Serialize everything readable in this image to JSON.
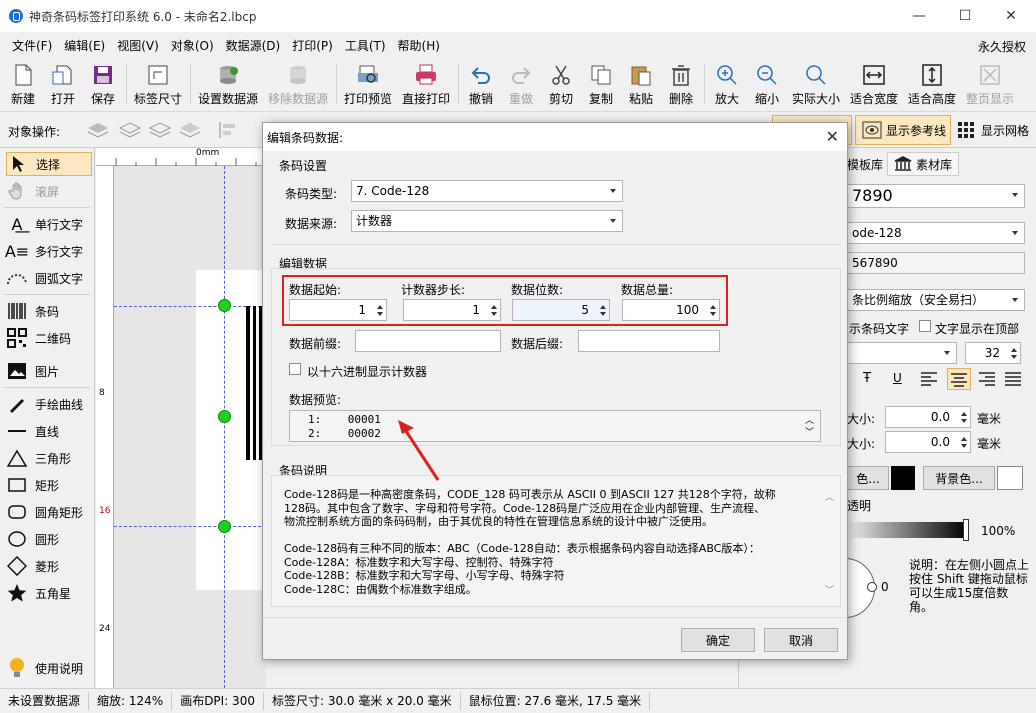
{
  "window": {
    "title": "神奇条码标签打印系统 6.0 - 未命名2.lbcp",
    "minimize": "—",
    "maximize": "☐",
    "close": "✕"
  },
  "menu": [
    "文件(F)",
    "编辑(E)",
    "视图(V)",
    "对象(O)",
    "数据源(D)",
    "打印(P)",
    "工具(T)",
    "帮助(H)"
  ],
  "license": "永久授权",
  "toolbar": {
    "new": "新建",
    "open": "打开",
    "save": "保存",
    "label_size": "标签尺寸",
    "set_datasource": "设置数据源",
    "remove_datasource": "移除数据源",
    "print_preview": "打印预览",
    "direct_print": "直接打印",
    "undo": "撤销",
    "redo": "重做",
    "cut": "剪切",
    "copy": "复制",
    "paste": "粘贴",
    "delete": "删除",
    "zoom_in": "放大",
    "zoom_out": "缩小",
    "actual_size": "实际大小",
    "fit_width": "适合宽度",
    "fit_height": "适合高度",
    "full_page": "整页显示"
  },
  "oprow": {
    "label": "对象操作:",
    "show_guides": "显示参考线",
    "show_grid": "显示网格"
  },
  "leftpanel": {
    "select": "选择",
    "scroll": "滚屏",
    "single_text": "单行文字",
    "multi_text": "多行文字",
    "arc_text": "圆弧文字",
    "barcode": "条码",
    "qrcode": "二维码",
    "image": "图片",
    "freehand": "手绘曲线",
    "line": "直线",
    "triangle": "三角形",
    "rectangle": "矩形",
    "rounded_rect": "圆角矩形",
    "circle": "圆形",
    "diamond": "菱形",
    "star": "五角星",
    "help": "使用说明"
  },
  "ruler": {
    "top_zero": "0mm",
    "marks": [
      "8",
      "16",
      "24"
    ]
  },
  "rightpanel": {
    "tab_templates": "模板库",
    "tab_materials": "素材库",
    "value": "7890",
    "type": "ode-128",
    "data": "567890",
    "scale_mode": "条比例缩放（安全易扫）",
    "show_text": "示条码文字",
    "text_top": "文字显示在顶部",
    "font_size": "32",
    "size_label1": "大小:",
    "size_val1": "0.0",
    "unit1": "毫米",
    "size_label2": "大小:",
    "size_val2": "0.0",
    "unit2": "毫米",
    "fg_color": "色...",
    "bg_color": "背景色...",
    "transparency": "透明",
    "percent": "100%",
    "angle": "0",
    "note": "说明：在左侧小圆点上按住 Shift 键拖动鼠标可以生成15度倍数角。"
  },
  "status": [
    "未设置数据源",
    "缩放: 124%",
    "画布DPI: 300",
    "标签尺寸: 30.0 毫米 x 20.0 毫米",
    "鼠标位置: 27.6 毫米, 17.5 毫米"
  ],
  "dialog": {
    "title": "编辑条码数据:",
    "barcode_settings": "条码设置",
    "type_label": "条码类型:",
    "type_value": "7. Code-128",
    "source_label": "数据来源:",
    "source_value": "计数器",
    "edit_data": "编辑数据",
    "start_label": "数据起始:",
    "start_value": "1",
    "step_label": "计数器步长:",
    "step_value": "1",
    "digits_label": "数据位数:",
    "digits_value": "5",
    "total_label": "数据总量:",
    "total_value": "100",
    "prefix_label": "数据前缀:",
    "suffix_label": "数据后缀:",
    "hex_label": "以十六进制显示计数器",
    "preview_label": "数据预览:",
    "preview_rows": [
      {
        "idx": "1:",
        "val": "00001"
      },
      {
        "idx": "2:",
        "val": "00002"
      }
    ],
    "desc_title": "条码说明",
    "desc_lines": [
      "Code-128码是一种高密度条码，CODE_128 码可表示从 ASCII 0 到ASCII 127 共128个字符，故称",
      "128码。其中包含了数字、字母和符号字符。Code-128码是广泛应用在企业内部管理、生产流程、",
      "物流控制系统方面的条码码制，由于其优良的特性在管理信息系统的设计中被广泛使用。",
      "",
      "Code-128码有三种不同的版本：ABC（Code-128自动：表示根据条码内容自动选择ABC版本）：",
      "Code-128A：标准数字和大写字母、控制符、特殊字符",
      "Code-128B：标准数字和大写字母、小写字母、特殊字符",
      "Code-128C：由偶数个标准数字组成。"
    ],
    "ok": "确定",
    "cancel": "取消"
  }
}
